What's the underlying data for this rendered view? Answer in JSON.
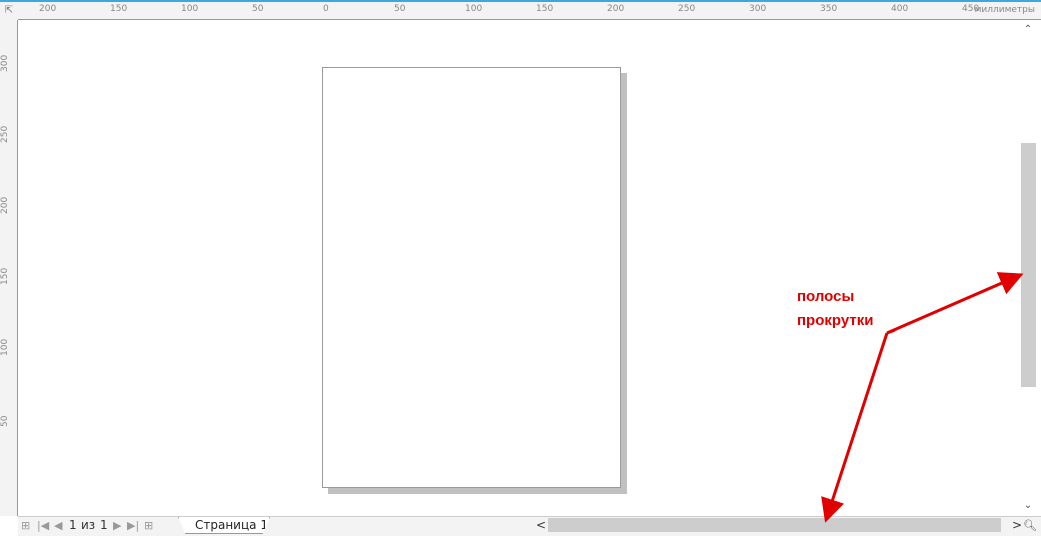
{
  "ruler": {
    "unit": "миллиметры",
    "h_ticks": [
      "200",
      "150",
      "100",
      "50",
      "0",
      "50",
      "100",
      "150",
      "200",
      "250",
      "300",
      "350",
      "400",
      "450"
    ],
    "v_ticks": [
      "300",
      "250",
      "200",
      "150",
      "100",
      "50"
    ]
  },
  "pager": {
    "current": "1",
    "of": "из",
    "total": "1"
  },
  "tabs": [
    {
      "label": "Страница 1"
    }
  ],
  "annotation": {
    "line1": "полосы",
    "line2": "прокрутки",
    "color": "#e00000"
  }
}
